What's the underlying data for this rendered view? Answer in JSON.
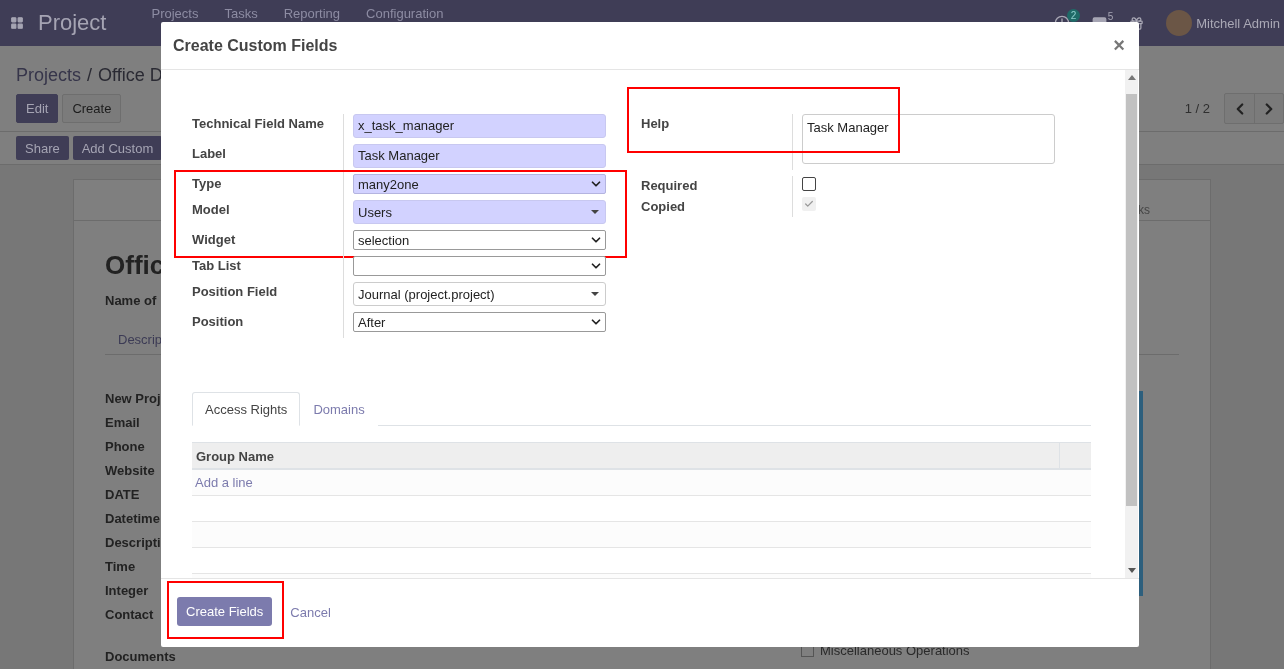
{
  "navbar": {
    "app_name": "Project",
    "menu": [
      "Projects",
      "Tasks",
      "Reporting",
      "Configuration"
    ],
    "activity_count": "2",
    "message_count": "5",
    "user_name": "Mitchell Admin"
  },
  "breadcrumb": {
    "separator": "/",
    "items": [
      "Projects",
      "Office D"
    ]
  },
  "actions": [
    {
      "label": "Edit",
      "primary": true
    },
    {
      "label": "Create",
      "primary": false
    }
  ],
  "pager": "1 / 2",
  "toolbar_buttons": [
    "Share",
    "Add Custom"
  ],
  "record": {
    "stat_label": "ks",
    "title": "Offic",
    "subtitle": "Name of",
    "tab": "Descrip",
    "labels": [
      "New Proj",
      "Email",
      "Phone",
      "Website",
      "DATE",
      "Datetime",
      "Descripti",
      "Time",
      "Integer",
      "Contact"
    ],
    "section": "Documents",
    "checklist": [
      {
        "label": "Miscellaneous Operations",
        "checked": false
      }
    ]
  },
  "dialog": {
    "title": "Create Custom Fields",
    "close": "×",
    "fields_left": [
      {
        "label": "Technical Field Name",
        "kind": "input",
        "value": "x_task_manager",
        "required": true
      },
      {
        "label": "Label",
        "kind": "input",
        "value": "Task Manager",
        "required": true
      },
      {
        "label": "Type",
        "kind": "select",
        "value": "many2one",
        "required": true,
        "highlighted": true
      },
      {
        "label": "Model",
        "kind": "many2one",
        "value": "Users",
        "required": true,
        "highlighted": true
      },
      {
        "label": "Widget",
        "kind": "select",
        "value": "selection",
        "required": false,
        "highlighted": true
      },
      {
        "label": "Tab List",
        "kind": "select",
        "required": false
      },
      {
        "label": "Position Field",
        "kind": "many2one",
        "value": "Journal (project.project)",
        "required": false
      },
      {
        "label": "Position",
        "kind": "select",
        "value": "After",
        "required": false
      }
    ],
    "fields_right": [
      {
        "label": "Help",
        "kind": "textarea",
        "value": "Task Manager",
        "highlighted": true
      },
      {
        "label": "Required",
        "kind": "checkbox",
        "checked": false,
        "disabled": false
      },
      {
        "label": "Copied",
        "kind": "checkbox",
        "checked": true,
        "disabled": true
      }
    ],
    "tabs": [
      {
        "label": "Access Rights",
        "selected": true
      },
      {
        "label": "Domains",
        "selected": false
      }
    ],
    "table": {
      "columns": [
        "Group Name"
      ],
      "add_line": "Add a line"
    },
    "buttons": [
      {
        "label": "Create Fields",
        "primary": true,
        "highlighted": true
      },
      {
        "label": "Cancel",
        "primary": false
      }
    ]
  }
}
